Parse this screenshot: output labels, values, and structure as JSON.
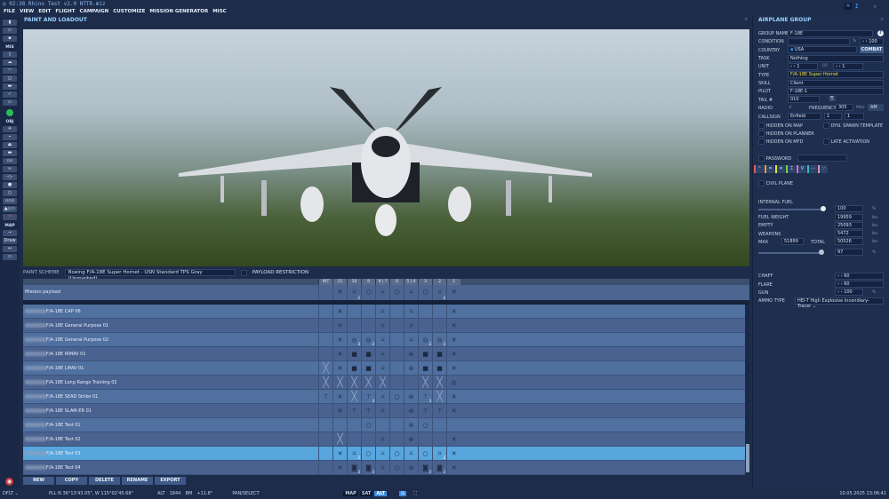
{
  "window": {
    "title": "02:38 Rhino Test v2.0  NTTR.miz"
  },
  "menu": [
    "FILE",
    "VIEW",
    "EDIT",
    "FLIGHT",
    "CAMPAIGN",
    "CUSTOMIZE",
    "MISSION GENERATOR",
    "MISC"
  ],
  "left_toolbar": {
    "section_mis": "MIS",
    "section_obj": "OBJ",
    "section_map": "MAP",
    "draw_label": "Draw"
  },
  "panel": {
    "title": "PAINT AND LOADOUT",
    "paint_scheme_label": "PAINT SCHEME",
    "paint_scheme_value": "Boeing F/A-18E Super Hornet - USN Standard TPS Gray (Unmarked)",
    "payload_restriction_label": "PAYLOAD RESTRICTION"
  },
  "payload_table": {
    "columns": [
      "INT",
      "11",
      "10",
      "9",
      "8 | 7",
      "6",
      "5 | 4",
      "3",
      "2",
      "1"
    ],
    "mission_payload": {
      "name": "Mission payload",
      "cells": [
        "",
        "x",
        "p2",
        "o",
        "p",
        "o",
        "p",
        "o",
        "p2",
        "x"
      ]
    },
    "rows": [
      {
        "name": "F/A-18E CAP 06",
        "cells": [
          "",
          "x",
          "",
          "",
          "p",
          "",
          "p",
          "",
          "",
          "x"
        ]
      },
      {
        "name": "F/A-18E General Purpose 01",
        "cells": [
          "",
          "x",
          "",
          "",
          "p",
          "",
          "p",
          "",
          "",
          "x"
        ]
      },
      {
        "name": "F/A-18E General Purpose 02",
        "cells": [
          "",
          "x",
          "t3",
          "t3",
          "p",
          "",
          "p",
          "t3",
          "t3",
          "x"
        ]
      },
      {
        "name": "F/A-18E IRMAV 01",
        "cells": [
          "",
          "x",
          "b",
          "b",
          "p",
          "",
          "m",
          "b",
          "b",
          "x"
        ]
      },
      {
        "name": "F/A-18E LMAV 01",
        "cells": [
          "X",
          "x",
          "b",
          "b",
          "p",
          "",
          "m",
          "b",
          "b",
          "x"
        ]
      },
      {
        "name": "F/A-18E Long Range Training 02",
        "cells": [
          "X",
          "X",
          "X",
          "X",
          "X",
          "",
          "",
          "X",
          "X",
          "t"
        ]
      },
      {
        "name": "F/A-18E SEAD Strike 01",
        "cells": [
          "r",
          "x",
          "X",
          "r3",
          "p",
          "o",
          "m",
          "r3",
          "X",
          "x"
        ]
      },
      {
        "name": "F/A-18E SLAM-ER 01",
        "cells": [
          "",
          "x",
          "r",
          "r",
          "p",
          "",
          "m",
          "r",
          "r",
          "x"
        ]
      },
      {
        "name": "F/A-18E Test 01",
        "cells": [
          "",
          "",
          "",
          "o",
          "",
          "",
          "m",
          "o",
          "",
          ""
        ]
      },
      {
        "name": "F/A-18E Test 02",
        "cells": [
          "",
          "X",
          "",
          "",
          "p",
          "",
          "m",
          "",
          "",
          "x"
        ]
      },
      {
        "name": "F/A-18E Test 03",
        "cells": [
          "",
          "x",
          "p2",
          "o",
          "p",
          "o",
          "p",
          "o",
          "p2",
          "x"
        ],
        "selected": true
      },
      {
        "name": "F/A-18E Test 04",
        "cells": [
          "",
          "x",
          "c3",
          "c3",
          "p",
          "o",
          "m",
          "c3",
          "c3",
          "x"
        ]
      }
    ]
  },
  "buttons": [
    "NEW",
    "COPY",
    "DELETE",
    "RENAME",
    "EXPORT"
  ],
  "group": {
    "title": "AIRPLANE GROUP",
    "group_name_label": "GROUP NAME",
    "group_name": "F-18E",
    "help": "?",
    "condition_label": "CONDITION",
    "condition_pct": "%",
    "condition_value": "100",
    "country_label": "COUNTRY",
    "country": "USA",
    "coalition": "COMBAT",
    "task_label": "TASK",
    "task": "Nothing",
    "unit_label": "UNIT",
    "unit": "1",
    "of_label": "OF",
    "unit_of": "1",
    "type_label": "TYPE",
    "type": "F/A-18E Super Hornet",
    "skill_label": "SKILL",
    "skill": "Client",
    "pilot_label": "PILOT",
    "pilot": "F-18E-1",
    "tail_label": "TAIL #",
    "tail": "010",
    "radio_label": "RADIO",
    "frequency_label": "FREQUENCY",
    "frequency": "305",
    "freq_unit": "MHz",
    "modulation": "AM",
    "callsign_label": "CALLSIGN",
    "callsign": "Enfield",
    "callsign_n1": "1",
    "callsign_n2": "1",
    "hidden_on_map": "HIDDEN ON MAP",
    "dyn_spawn": "DYN. SPAWN TEMPLATE",
    "hidden_on_planner": "HIDDEN ON PLANNER",
    "hidden_on_mfd": "HIDDEN ON MFD",
    "late_activation": "LATE ACTIVATION",
    "password_label": "PASSWORD",
    "civil_plane": "CIVIL PLANE",
    "tab_colors": [
      "#e05a5a",
      "#e8a33a",
      "#e8e03a",
      "#7ad04a",
      "#d070e0",
      "#30b8d0",
      "#e890b0"
    ],
    "fuel": {
      "label": "INTERNAL FUEL",
      "percent": 100,
      "percent_text": "100",
      "fuel_weight_label": "FUEL WEIGHT",
      "fuel_weight": "19959",
      "empty_label": "EMPTY",
      "empty": "25093",
      "weapons_label": "WEAPONS",
      "weapons": "5472",
      "max_label": "MAX",
      "max": "51899",
      "total_label": "TOTAL",
      "total": "50526",
      "total_pct": 97,
      "total_pct_text": "97",
      "lbs": "lbs",
      "pct": "%"
    },
    "chaff_label": "CHAFF",
    "chaff": "60",
    "flare_label": "FLARE",
    "flare": "60",
    "gun_label": "GUN",
    "gun": "100",
    "ammo_label": "AMMO TYPE",
    "ammo": "HEI-T High Explosive Incendiary-Tracer"
  },
  "status": {
    "profile": "DFLT",
    "coords": "PLL  N 36°13'43.05\", W 115°02'45.68\"",
    "alt_label": "ALT",
    "alt": "1844",
    "bm_label": "BM",
    "bm": "+11.8°",
    "mode": "PAN/SELECT",
    "map_btn": "MAP",
    "sat_btn": "SAT",
    "alt_btn": "ALT",
    "datetime": "10.05.2025 13:06:41"
  }
}
